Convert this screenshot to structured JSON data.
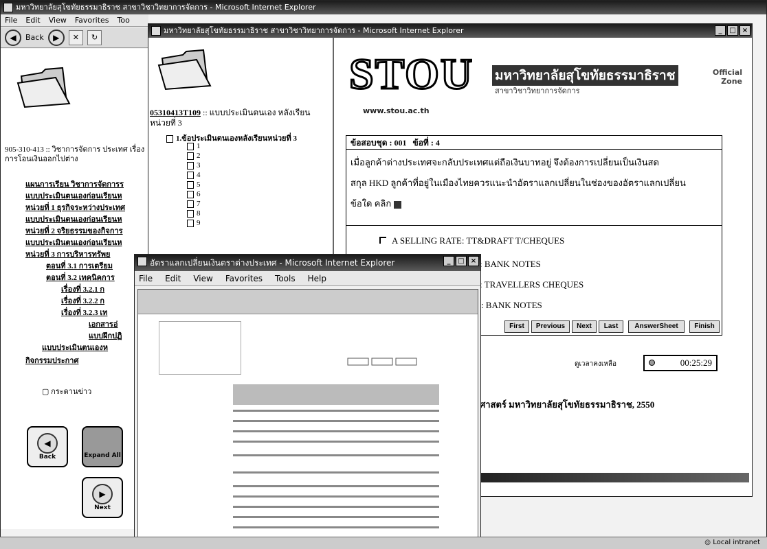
{
  "back_window": {
    "title": "มหาวิทยาลัยสุโขทัยธรรมาธิราช สาขาวิชาวิทยาการจัดการ - Microsoft Internet Explorer",
    "menu": [
      "File",
      "Edit",
      "View",
      "Favorites",
      "Too"
    ],
    "back_label": "Back",
    "course_title": "905-310-413 :: วิชาการจัดการ ประเทศ เรื่องการโอนเงินออกไปต่าง",
    "tree_items": [
      "แผนการเรียน วิชาการจัดการร",
      "แบบประเมินตนเองก่อนเรียนห",
      "หน่วยที่ 1 ธุรกิจระหว่างประเทศ",
      "แบบประเมินตนเองก่อนเรียนห",
      "หน่วยที่ 2 จริยธรรมของกิจการ",
      "แบบประเมินตนเองก่อนเรียนห",
      "หน่วยที่ 3 การบริหารทรัพย",
      "ตอนที่ 3.1 การเตรียม",
      "ตอนที่ 3.2 เทคนิคการ",
      "เรื่องที่ 3.2.1 ก",
      "เรื่องที่ 3.2.2 ก",
      "เรื่องที่ 3.2.3 เท",
      "เอกสารอ่",
      "แบบฝึกปฏิ",
      "แบบประเมินตนเองห",
      "กิจกรรมประกาศ"
    ],
    "newspaper_label": "กระดานข่าว",
    "nav_back": "Back",
    "nav_expand": "Expand All",
    "nav_next": "Next"
  },
  "mid_window": {
    "title": "มหาวิทยาลัยสุโขทัยธรรมาธิราช สาขาวิชาวิทยาการจัดการ - Microsoft Internet Explorer",
    "test_code": "05310413T109",
    "test_title": ":: แบบประเมินตนเอง หลังเรียนหน่วยที่ 3",
    "test_node": "1.ข้อประเมินตนเองหลังเรียนหน่วยที่ 3",
    "question_numbers": [
      "1",
      "2",
      "3",
      "4",
      "5",
      "6",
      "7",
      "8",
      "9"
    ],
    "logo_text": "STOU",
    "university_name": "มหาวิทยาลัยสุโขทัยธรรมาธิราช",
    "university_sub": "สาขาวิชาวิทยาการจัดการ",
    "official_zone": "Official Zone",
    "website": "www.stou.ac.th",
    "part_label": "ข้อสอบชุด : 001",
    "question_label": "ข้อที่ : 4",
    "question_text_1": "เมื่อลูกค้าต่างประเทศจะกลับประเทศแต่ถือเงินบาทอยู่ จึงต้องการเปลี่ยนเป็นเงินสด",
    "question_text_2": "สกุล HKD ลูกค้าที่อยู่ในเมืองไทยควรแนะนำอัตราแลกเปลี่ยนในช่องของอัตราแลกเปลี่ยน",
    "question_text_3": "ข้อใด คลิก",
    "option_a": "A  SELLING RATE: TT&DRAFT T/CHEQUES",
    "option_b": ": BANK NOTES",
    "option_c": ": TRAVELLERS CHEQUES",
    "option_d": "E: BANK NOTES",
    "buttons": [
      "First",
      "Previous",
      "Next",
      "Last",
      "AnswerSheet",
      "Finish"
    ],
    "time_label": "ดูเวลาคงเหลือ",
    "timer": "00:25:29",
    "copyright": "ศาสตร์ มหาวิทยาลัยสุโขทัยธรรมาธิราช, 2550"
  },
  "front_window": {
    "title": "อัตราแลกเปลี่ยนเงินตราต่างประเทศ - Microsoft Internet Explorer",
    "menu": [
      "File",
      "Edit",
      "View",
      "Favorites",
      "Tools",
      "Help"
    ]
  },
  "statusbar": {
    "zone": "Local intranet"
  }
}
